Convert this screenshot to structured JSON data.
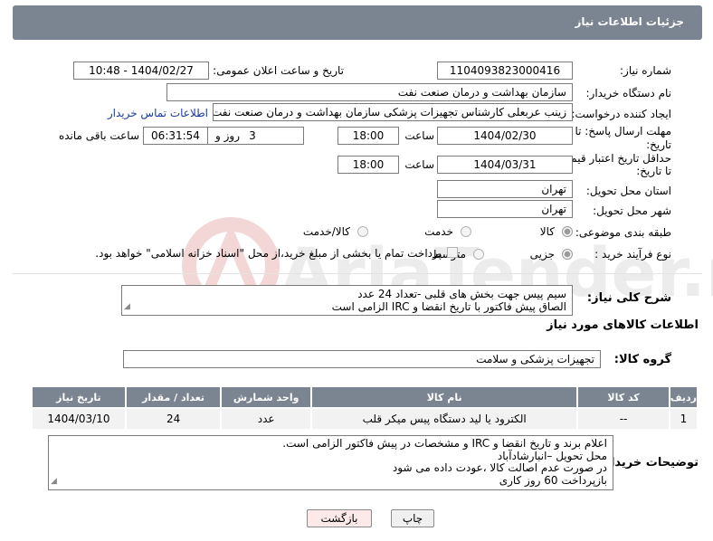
{
  "header": {
    "title": "جزئیات اطلاعات نیاز"
  },
  "need_number": {
    "label": "شماره نیاز:",
    "value": "1104093823000416"
  },
  "announce": {
    "label": "تاریخ و ساعت اعلان عمومی:",
    "value": "1404/02/27 - 10:48"
  },
  "buyer_org": {
    "label": "نام دستگاه خریدار:",
    "value": "سازمان بهداشت و درمان صنعت نفت"
  },
  "requester": {
    "label": "ایجاد کننده درخواست:",
    "value": "زینب عربعلی کارشناس تجهیزات پزشکی سازمان بهداشت و درمان صنعت نفت",
    "contact_link": "اطلاعات تماس خریدار"
  },
  "deadline": {
    "label_line1": "مهلت ارسال پاسخ: تا",
    "label_line2": "تاریخ:",
    "date": "1404/02/30",
    "time_label": "ساعت",
    "time": "18:00",
    "days": "3",
    "days_label": "روز و",
    "remaining": "06:31:54",
    "remaining_label": "ساعت باقی مانده"
  },
  "price_validity": {
    "label_line1": "حداقل تاریخ اعتبار قیمت:",
    "label_line2": "تا تاریخ:",
    "date": "1404/03/31",
    "time_label": "ساعت",
    "time": "18:00"
  },
  "province": {
    "label": "استان محل تحویل:",
    "value": "تهران"
  },
  "city": {
    "label": "شهر محل تحویل:",
    "value": "تهران"
  },
  "category": {
    "label": "طبقه بندی موضوعی:",
    "options": [
      "کالا",
      "خدمت",
      "کالا/خدمت"
    ],
    "selected": "کالا"
  },
  "process": {
    "label": "نوع فرآیند خرید :",
    "options": [
      "جزیی",
      "متوسط"
    ],
    "selected": "جزیی",
    "payment_note": "پرداخت تمام یا بخشی از مبلغ خرید،از محل \"اسناد خزانه اسلامی\" خواهد بود."
  },
  "summary": {
    "label": "شرح کلی نیاز:",
    "line1": "سیم پیس جهت بخش های قلبی -تعداد 24 عدد",
    "line2": "الصاق پیش فاکتور با تاریخ انقضا و IRC الزامی است"
  },
  "goods_info_title": "اطلاعات کالاهای مورد نیاز",
  "goods_group": {
    "label": "گروه کالا:",
    "value": "تجهیزات پزشکی و سلامت"
  },
  "table": {
    "headers": [
      "ردیف",
      "کد کالا",
      "نام کالا",
      "واحد شمارش",
      "تعداد / مقدار",
      "تاریخ نیاز"
    ],
    "rows": [
      [
        "1",
        "--",
        "الکترود یا لید دستگاه پیس میکر قلب",
        "عدد",
        "24",
        "1404/03/10"
      ]
    ]
  },
  "buyer_notes": {
    "label": "توضیحات خریدار:",
    "lines": [
      "اعلام برند و تاریخ انقضا  و IRC  و مشخصات  در پیش فاکتور الزامی است.",
      "محل تحویل –انبارشادآباد",
      "در صورت عدم اصالت کالا ،عودت داده می شود",
      "بازپرداخت 60 روز کاری"
    ]
  },
  "buttons": {
    "print": "چاپ",
    "back": "بازگشت"
  },
  "watermark": {
    "text": "AriaTender.neT"
  },
  "colors": {
    "header_bg": "#7a8591",
    "link": "#1a3d9e",
    "back_button_bg": "#fde9ea"
  }
}
